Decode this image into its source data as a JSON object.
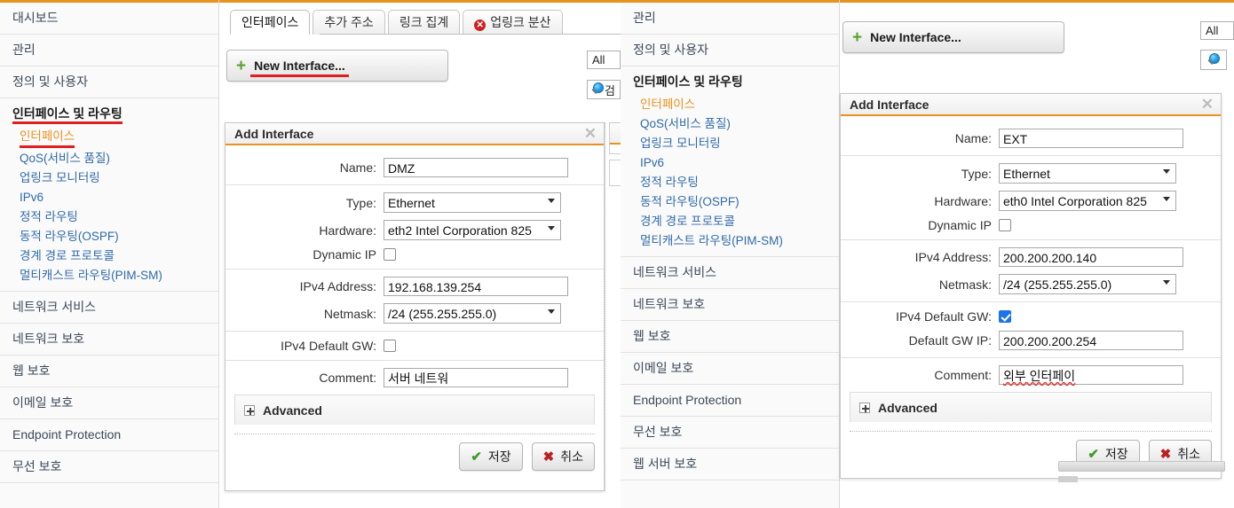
{
  "colors": {
    "accent_orange": "#e8921f",
    "annotation_red": "#e02020",
    "link_blue": "#2f6aa8",
    "checkbox_blue": "#1a73e8",
    "save_green": "#3f9b2b",
    "cancel_red": "#b92020"
  },
  "sidebar_left": {
    "items": [
      {
        "label": "대시보드",
        "type": "item"
      },
      {
        "label": "관리",
        "type": "item"
      },
      {
        "label": "정의 및 사용자",
        "type": "item"
      },
      {
        "label": "인터페이스 및 라우팅",
        "type": "group",
        "underlined": true
      },
      {
        "label": "무선 보호",
        "type": "item"
      }
    ],
    "group_children": [
      {
        "label": "인터페이스",
        "active": true,
        "underlined": true
      },
      {
        "label": "QoS(서비스 품질)",
        "active": false
      },
      {
        "label": "업링크 모니터링",
        "active": false
      },
      {
        "label": "IPv6",
        "active": false
      },
      {
        "label": "정적 라우팅",
        "active": false
      },
      {
        "label": "동적 라우팅(OSPF)",
        "active": false
      },
      {
        "label": "경계 경로 프로토콜",
        "active": false
      },
      {
        "label": "멀티캐스트 라우팅(PIM-SM)",
        "active": false
      }
    ],
    "tail_items": [
      {
        "label": "네트워크 서비스"
      },
      {
        "label": "네트워크 보호"
      },
      {
        "label": "웹 보호"
      },
      {
        "label": "이메일 보호"
      },
      {
        "label": "Endpoint Protection"
      },
      {
        "label": "무선 보호"
      }
    ]
  },
  "sidebar_middle": {
    "items": [
      {
        "label": "관리"
      },
      {
        "label": "정의 및 사용자"
      }
    ],
    "group_label": "인터페이스 및 라우팅",
    "group_children": [
      {
        "label": "인터페이스",
        "active": true
      },
      {
        "label": "QoS(서비스 품질)",
        "active": false
      },
      {
        "label": "업링크 모니터링",
        "active": false
      },
      {
        "label": "IPv6",
        "active": false
      },
      {
        "label": "정적 라우팅",
        "active": false
      },
      {
        "label": "동적 라우팅(OSPF)",
        "active": false
      },
      {
        "label": "경계 경로 프로토콜",
        "active": false
      },
      {
        "label": "멀티캐스트 라우팅(PIM-SM)",
        "active": false
      }
    ],
    "tail_items": [
      {
        "label": "네트워크 서비스"
      },
      {
        "label": "네트워크 보호"
      },
      {
        "label": "웹 보호"
      },
      {
        "label": "이메일 보호"
      },
      {
        "label": "Endpoint Protection"
      },
      {
        "label": "무선 보호"
      },
      {
        "label": "웹 서버 보호"
      }
    ]
  },
  "panel_left": {
    "tabs": [
      {
        "label": "인터페이스",
        "active": true,
        "error": false
      },
      {
        "label": "추가 주소",
        "active": false,
        "error": false
      },
      {
        "label": "링크 집계",
        "active": false,
        "error": false
      },
      {
        "label": "업링크 분산",
        "active": false,
        "error": true,
        "error_glyph": "✕"
      }
    ],
    "new_interface_button": "New Interface...",
    "plus_icon": "plus-icon",
    "filter_value": "All",
    "search_label": "검",
    "search_icon": "search-icon",
    "dialog": {
      "title": "Add Interface",
      "close_icon": "close-icon",
      "fields": {
        "name_label": "Name:",
        "name_value": "DMZ",
        "type_label": "Type:",
        "type_value": "Ethernet",
        "hardware_label": "Hardware:",
        "hardware_value": "eth2 Intel Corporation 825",
        "dynamic_ip_label": "Dynamic IP",
        "dynamic_ip_checked": false,
        "ipv4_label": "IPv4 Address:",
        "ipv4_value": "192.168.139.254",
        "netmask_label": "Netmask:",
        "netmask_value": "/24 (255.255.255.0)",
        "gw_label": "IPv4 Default GW:",
        "gw_checked": false,
        "comment_label": "Comment:",
        "comment_value": "서버 네트워"
      },
      "advanced_label": "Advanced",
      "save_label": "저장",
      "cancel_label": "취소"
    }
  },
  "panel_right": {
    "new_interface_button": "New Interface...",
    "plus_icon": "plus-icon",
    "filter_value": "All",
    "search_icon": "search-icon",
    "dialog": {
      "title": "Add Interface",
      "close_icon": "close-icon",
      "fields": {
        "name_label": "Name:",
        "name_value": "EXT",
        "type_label": "Type:",
        "type_value": "Ethernet",
        "hardware_label": "Hardware:",
        "hardware_value": "eth0 Intel Corporation 825",
        "dynamic_ip_label": "Dynamic IP",
        "dynamic_ip_checked": false,
        "ipv4_label": "IPv4 Address:",
        "ipv4_value": "200.200.200.140",
        "netmask_label": "Netmask:",
        "netmask_value": "/24 (255.255.255.0)",
        "gw_label": "IPv4 Default GW:",
        "gw_checked": true,
        "gwip_label": "Default GW IP:",
        "gwip_value": "200.200.200.254",
        "comment_label": "Comment:",
        "comment_value": "외부 인터페이"
      },
      "advanced_label": "Advanced",
      "save_label": "저장",
      "cancel_label": "취소"
    }
  }
}
